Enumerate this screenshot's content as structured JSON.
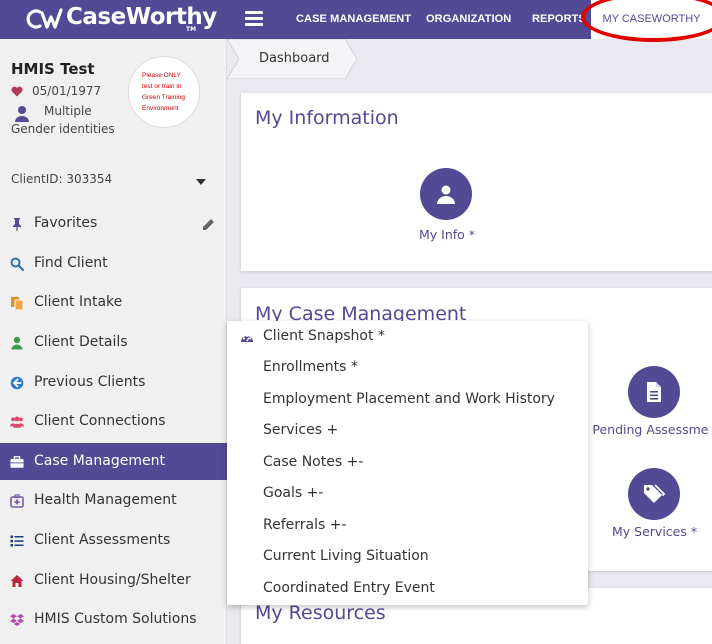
{
  "app": {
    "brand": "CaseWorthy",
    "tm": "TM"
  },
  "colors": {
    "brand": "#524a94",
    "annotation": "#e00000",
    "active_nav_bg": "#ffffff"
  },
  "topnav": {
    "items": [
      "CASE MANAGEMENT",
      "ORGANIZATION",
      "REPORTS"
    ],
    "active": "MY CASEWORTHY"
  },
  "client": {
    "name": "HMIS Test",
    "dob": "05/01/1977",
    "gender": "Multiple Gender identities",
    "client_id": "ClientID: 303354",
    "warning": "Please ONLY test or train in Green Training Environment"
  },
  "sidebar": {
    "items": [
      {
        "label": "Favorites",
        "icon": "pin-icon"
      },
      {
        "label": "Find Client",
        "icon": "search-icon"
      },
      {
        "label": "Client Intake",
        "icon": "intake-icon"
      },
      {
        "label": "Client Details",
        "icon": "user-icon"
      },
      {
        "label": "Previous Clients",
        "icon": "back-circle-icon"
      },
      {
        "label": "Client Connections",
        "icon": "users-icon"
      },
      {
        "label": "Case Management",
        "icon": "briefcase-icon",
        "active": true
      },
      {
        "label": "Health Management",
        "icon": "medkit-icon"
      },
      {
        "label": "Client Assessments",
        "icon": "list-icon"
      },
      {
        "label": "Client Housing/Shelter",
        "icon": "home-icon"
      },
      {
        "label": "HMIS Custom Solutions",
        "icon": "dropbox-icon"
      }
    ]
  },
  "breadcrumb": {
    "label": "Dashboard"
  },
  "cards": {
    "my_information": {
      "title": "My Information",
      "tile_label": "My Info *"
    },
    "my_case_management": {
      "title": "My Case Management",
      "pending_label": "y Pending Assessme",
      "services_label": "My Services *"
    },
    "my_resources": {
      "title": "My Resources"
    }
  },
  "dropdown": {
    "items": [
      "Client Snapshot *",
      "Enrollments *",
      "Employment Placement and Work History",
      "Services +",
      "Case Notes +-",
      "Goals +-",
      "Referrals +-",
      "Current Living Situation",
      "Coordinated Entry Event"
    ]
  }
}
